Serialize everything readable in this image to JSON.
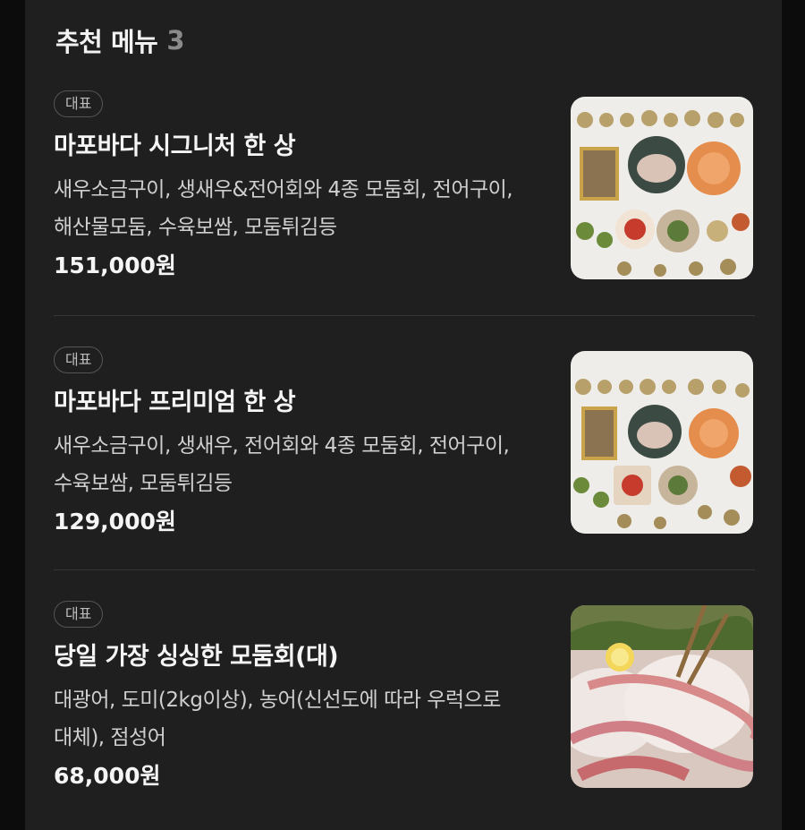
{
  "section": {
    "title": "추천 메뉴",
    "count": "3"
  },
  "items": [
    {
      "badge": "대표",
      "name": "마포바다 시그니처 한 상",
      "description": "새우소금구이, 생새우&전어회와 4종 모둠회, 전어구이, 해산물모둠, 수육보쌈, 모둠튀김등",
      "price": "151,000원"
    },
    {
      "badge": "대표",
      "name": "마포바다 프리미엄 한 상",
      "description": "새우소금구이, 생새우, 전어회와 4종 모둠회, 전어구이, 수육보쌈, 모둠튀김등",
      "price": "129,000원"
    },
    {
      "badge": "대표",
      "name": "당일 가장 싱싱한 모둠회(대)",
      "description": "대광어, 도미(2kg이상), 농어(신선도에 따라 우럭으로 대체), 점성어",
      "price": "68,000원"
    }
  ],
  "colors": {
    "background": "#0c0c0c",
    "panel": "#1f1f1f",
    "text_primary": "#f5f5f5",
    "text_secondary": "#cfcfcf",
    "count": "#8a8a8a"
  }
}
